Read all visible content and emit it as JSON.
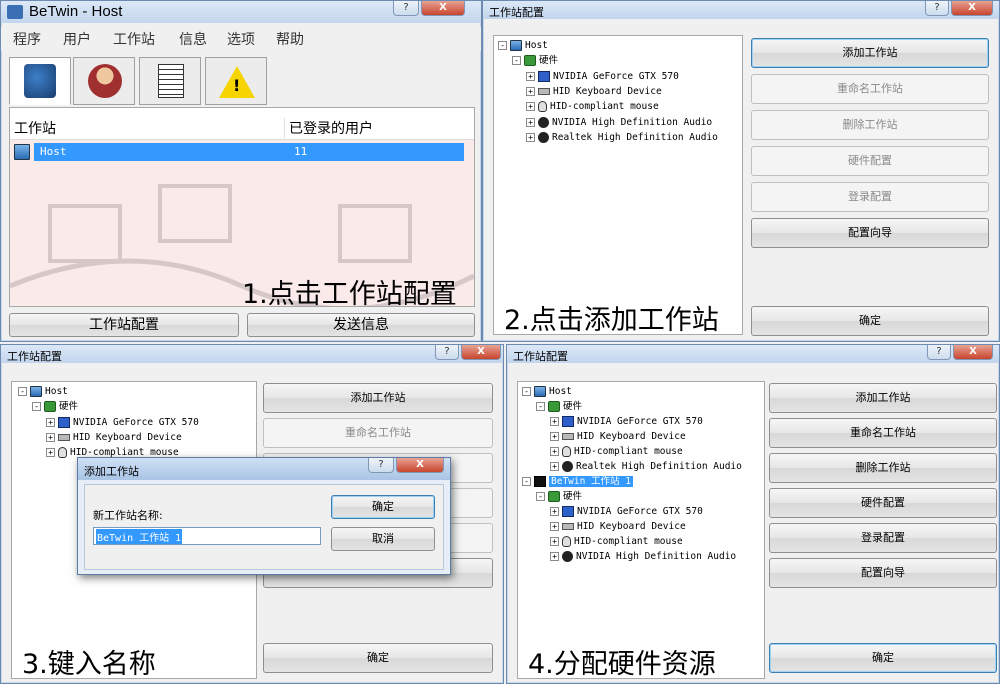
{
  "host_window": {
    "title": "BeTwin - Host",
    "help_btn": "?",
    "close_btn": "X",
    "menu": [
      "程序",
      "用户",
      "工作站",
      "信息",
      "选项",
      "帮助"
    ],
    "columns": [
      "工作站",
      "已登录的用户"
    ],
    "row": {
      "name": "Host",
      "users": "11"
    },
    "buttons": {
      "config": "工作站配置",
      "send": "发送信息"
    },
    "caption": "1.点击工作站配置"
  },
  "config_dialog": {
    "title": "工作站配置",
    "help_btn": "?",
    "close_btn": "X",
    "tree_root": "Host",
    "tree_hw": "硬件",
    "devices": [
      "NVIDIA GeForce GTX 570",
      "HID Keyboard Device",
      "HID-compliant mouse",
      "NVIDIA High Definition Audio",
      "Realtek High Definition Audio"
    ],
    "buttons": [
      "添加工作站",
      "重命名工作站",
      "删除工作站",
      "硬件配置",
      "登录配置",
      "配置向导"
    ],
    "ok": "确定"
  },
  "captions": [
    "2.点击添加工作站",
    "3.键入名称",
    "4.分配硬件资源"
  ],
  "add_dialog": {
    "title": "添加工作站",
    "help_btn": "?",
    "close_btn": "X",
    "label": "新工作站名称:",
    "value": "BeTwin 工作站 1",
    "ok": "确定",
    "cancel": "取消"
  },
  "step4": {
    "station": "BeTwin 工作站 1",
    "station_devices": [
      "NVIDIA GeForce GTX 570",
      "HID Keyboard Device",
      "HID-compliant mouse",
      "NVIDIA High Definition Audio"
    ]
  }
}
